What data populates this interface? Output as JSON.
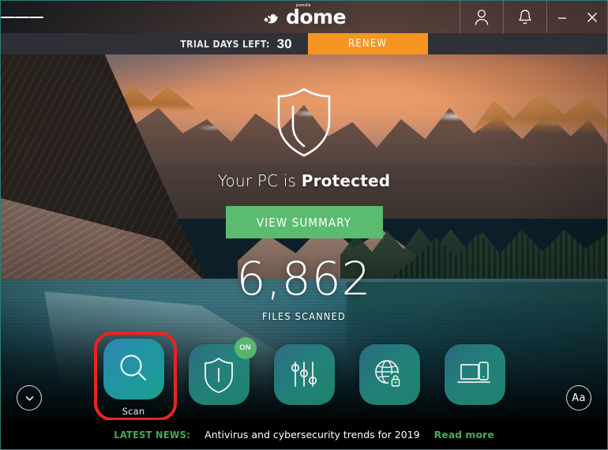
{
  "window": {
    "accent_border": "#2d7d77",
    "menu_icon": "hamburger-menu-icon",
    "minimize_label": "–",
    "close_label": "✕"
  },
  "brand": {
    "tiny": "panda",
    "word": "dome",
    "mark": "panda-logo-icon"
  },
  "titlebar_actions": [
    {
      "name": "account-button",
      "icon": "user-icon"
    },
    {
      "name": "notifications-button",
      "icon": "bell-icon"
    }
  ],
  "trial": {
    "label": "TRIAL DAYS LEFT:",
    "days": "30",
    "renew_label": "RENEW",
    "renew_color": "#f79522"
  },
  "status": {
    "shield_icon": "shield-outline-icon",
    "text_prefix": "Your PC is ",
    "text_strong": "Protected",
    "summary_label": "VIEW SUMMARY",
    "summary_color": "#5bbc70",
    "files_count": "6,862",
    "files_label": "FILES SCANNED"
  },
  "dock": {
    "items": [
      {
        "label": "Scan",
        "icon": "magnifier-icon",
        "badge": null,
        "highlighted": true
      },
      {
        "label": "",
        "icon": "shield-firewall-icon",
        "badge": "ON",
        "highlighted": false
      },
      {
        "label": "",
        "icon": "sliders-settings-icon",
        "badge": null,
        "highlighted": false
      },
      {
        "label": "",
        "icon": "globe-lock-vpn-icon",
        "badge": null,
        "highlighted": false
      },
      {
        "label": "",
        "icon": "devices-laptop-phone-icon",
        "badge": null,
        "highlighted": false
      }
    ],
    "highlight_color": "#ee2222"
  },
  "corner_buttons": {
    "expand": {
      "icon": "chevron-down-icon"
    },
    "text_size": {
      "label": "Aa"
    }
  },
  "news": {
    "label": "LATEST NEWS:",
    "headline": "Antivirus and cybersecurity trends for 2019",
    "read_more": "Read more",
    "accent": "#3fae58"
  }
}
